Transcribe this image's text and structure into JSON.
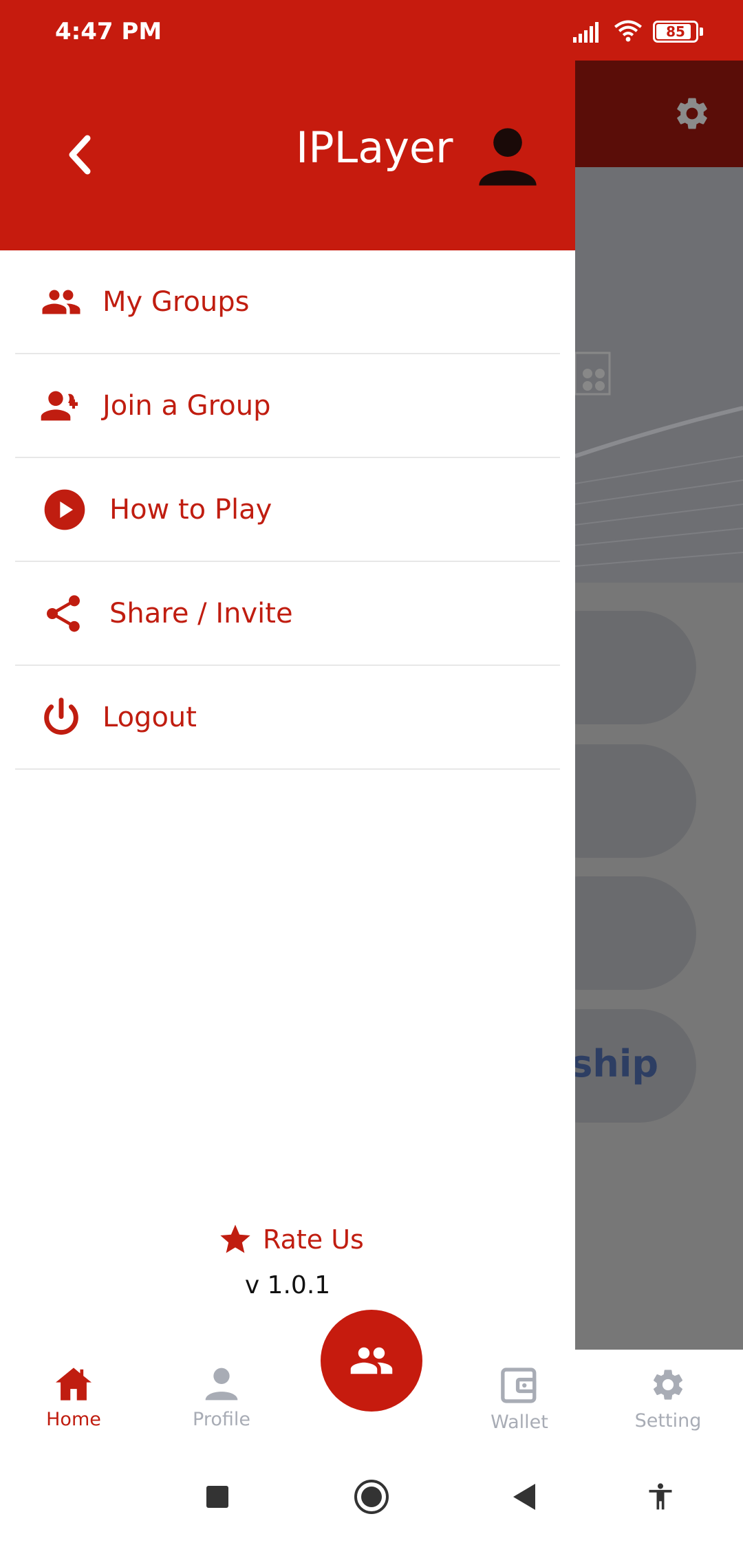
{
  "status_bar": {
    "time": "4:47 PM",
    "battery": "85"
  },
  "drawer": {
    "title": "IPLayer",
    "menu": [
      {
        "label": "My Groups",
        "icon": "group-icon"
      },
      {
        "label": "Join a Group",
        "icon": "person-add-icon"
      },
      {
        "label": "How to Play",
        "icon": "play-circle-icon"
      },
      {
        "label": "Share / Invite",
        "icon": "share-icon"
      },
      {
        "label": "Logout",
        "icon": "power-icon"
      }
    ],
    "rate_us": "Rate Us",
    "version": "v 1.0.1"
  },
  "background": {
    "partial_button_text": "nship"
  },
  "bottom_nav": {
    "items": [
      {
        "label": "Home",
        "icon": "home-icon",
        "active": true
      },
      {
        "label": "Profile",
        "icon": "person-icon",
        "active": false
      },
      {
        "label": "Wallet",
        "icon": "wallet-icon",
        "active": false
      },
      {
        "label": "Setting",
        "icon": "gear-icon",
        "active": false
      }
    ],
    "center_button_icon": "group-icon"
  },
  "colors": {
    "primary": "#c61b0e",
    "menu_text": "#c01d10",
    "inactive": "#a8acb5"
  }
}
